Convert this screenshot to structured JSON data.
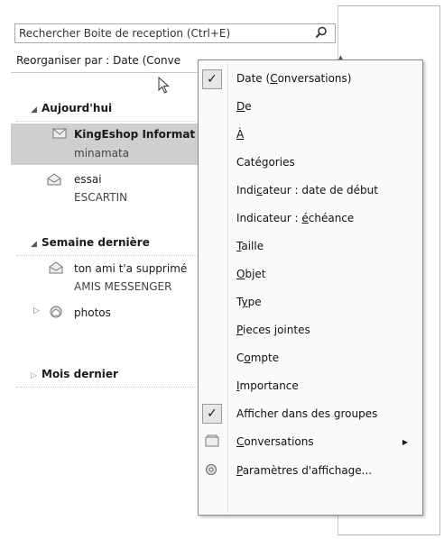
{
  "search": {
    "placeholder": "Rechercher Boite de reception (Ctrl+E)"
  },
  "sortbar": {
    "label": "Reorganiser par : Date (Conve"
  },
  "groups": {
    "today": "Aujourd'hui",
    "last_week": "Semaine dernière",
    "last_month": "Mois dernier"
  },
  "messages": [
    {
      "sender": "KingEshop Informat",
      "sub": "minamata"
    },
    {
      "sender": "essai",
      "sub": "ESCARTIN"
    },
    {
      "sender": "ton ami t'a supprimé",
      "sub": "AMIS MESSENGER"
    },
    {
      "sender": "photos",
      "sub": ""
    }
  ],
  "menu": {
    "items": [
      {
        "pre": "Date (",
        "u": "C",
        "post": "onversations)",
        "checked": true
      },
      {
        "pre": "",
        "u": "D",
        "post": "e",
        "checked": false
      },
      {
        "pre": "",
        "u": "À",
        "post": "",
        "checked": false
      },
      {
        "pre": "Caté",
        "u": "g",
        "post": "ories",
        "checked": false
      },
      {
        "pre": "Indi",
        "u": "c",
        "post": "ateur : date de début",
        "checked": false
      },
      {
        "pre": "Indicateur : ",
        "u": "é",
        "post": "chéance",
        "checked": false
      },
      {
        "pre": "",
        "u": "T",
        "post": "aille",
        "checked": false
      },
      {
        "pre": "",
        "u": "O",
        "post": "bjet",
        "checked": false
      },
      {
        "pre": "T",
        "u": "y",
        "post": "pe",
        "checked": false
      },
      {
        "pre": "",
        "u": "P",
        "post": "ieces jointes",
        "checked": false
      },
      {
        "pre": "C",
        "u": "o",
        "post": "mpte",
        "checked": false
      },
      {
        "pre": "",
        "u": "I",
        "post": "mportance",
        "checked": false
      },
      {
        "pre": "Af",
        "u": "f",
        "post": "icher dans des groupes",
        "checked": true
      },
      {
        "pre": "",
        "u": "C",
        "post": "onversations",
        "checked": false
      },
      {
        "pre": "",
        "u": "P",
        "post": "aramètres d'affichage...",
        "checked": false
      }
    ]
  }
}
